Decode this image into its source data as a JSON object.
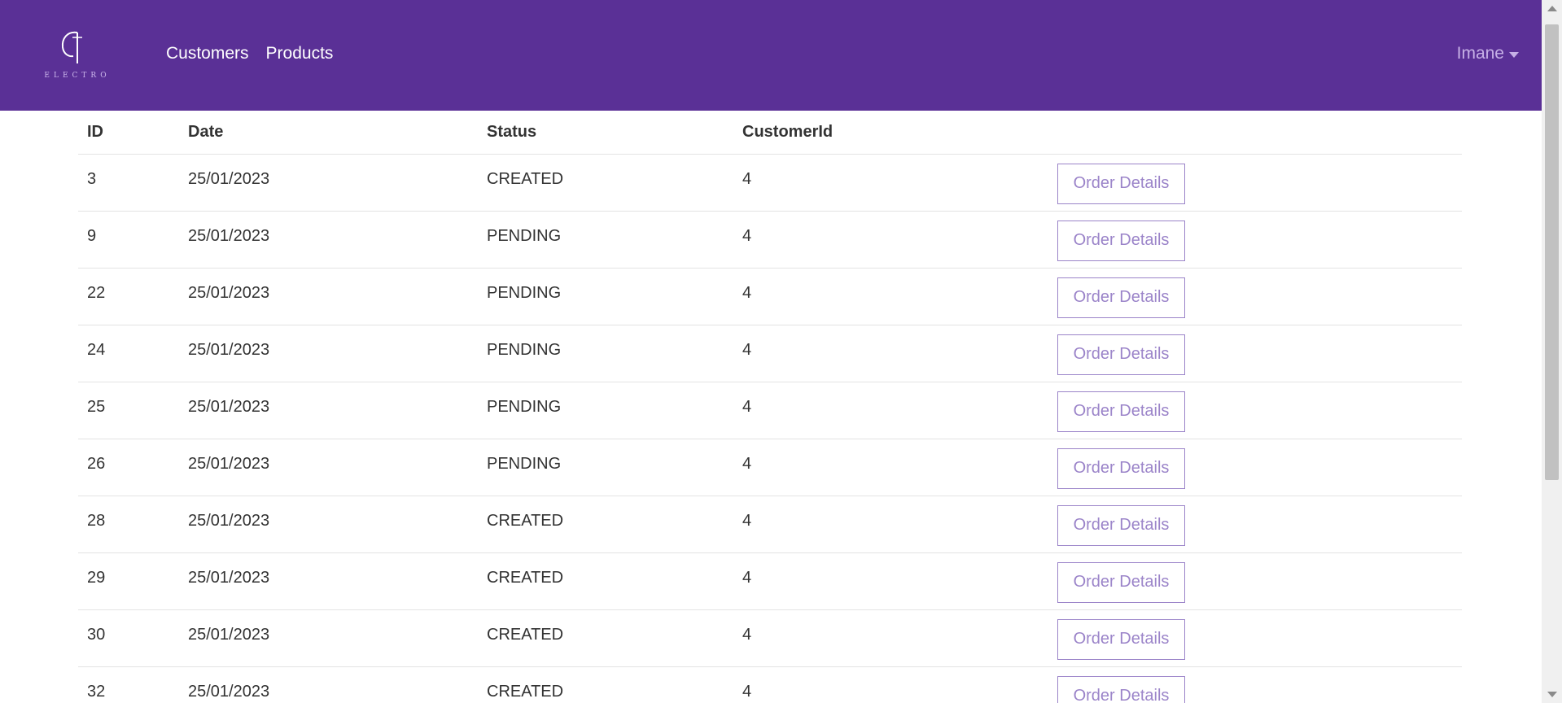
{
  "navbar": {
    "logo_text": "ELECTRO",
    "links": [
      {
        "label": "Customers"
      },
      {
        "label": "Products"
      }
    ],
    "user": "Imane"
  },
  "colors": {
    "navbar_bg": "#5a3096",
    "button_accent": "#9b84c9"
  },
  "orders": {
    "columns": [
      "ID",
      "Date",
      "Status",
      "CustomerId",
      ""
    ],
    "action_label": "Order Details",
    "rows": [
      {
        "id": "3",
        "date": "25/01/2023",
        "status": "CREATED",
        "customer_id": "4"
      },
      {
        "id": "9",
        "date": "25/01/2023",
        "status": "PENDING",
        "customer_id": "4"
      },
      {
        "id": "22",
        "date": "25/01/2023",
        "status": "PENDING",
        "customer_id": "4"
      },
      {
        "id": "24",
        "date": "25/01/2023",
        "status": "PENDING",
        "customer_id": "4"
      },
      {
        "id": "25",
        "date": "25/01/2023",
        "status": "PENDING",
        "customer_id": "4"
      },
      {
        "id": "26",
        "date": "25/01/2023",
        "status": "PENDING",
        "customer_id": "4"
      },
      {
        "id": "28",
        "date": "25/01/2023",
        "status": "CREATED",
        "customer_id": "4"
      },
      {
        "id": "29",
        "date": "25/01/2023",
        "status": "CREATED",
        "customer_id": "4"
      },
      {
        "id": "30",
        "date": "25/01/2023",
        "status": "CREATED",
        "customer_id": "4"
      },
      {
        "id": "32",
        "date": "25/01/2023",
        "status": "CREATED",
        "customer_id": "4"
      }
    ]
  }
}
